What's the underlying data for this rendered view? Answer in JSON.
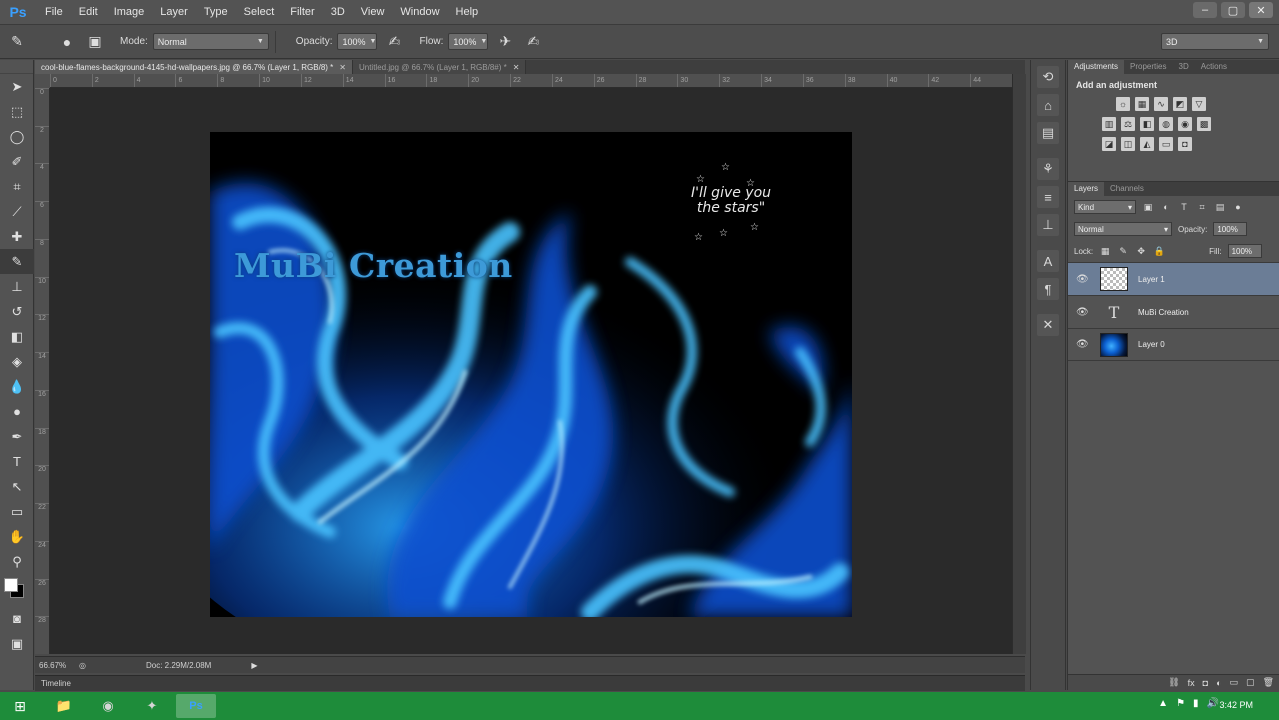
{
  "menubar": {
    "logo": "Ps",
    "items": [
      "File",
      "Edit",
      "Image",
      "Layer",
      "Type",
      "Select",
      "Filter",
      "3D",
      "View",
      "Window",
      "Help"
    ],
    "window_controls": [
      "–",
      "▢",
      "✕"
    ]
  },
  "options": {
    "mode_label": "Mode:",
    "mode_value": "Normal",
    "opacity_label": "Opacity:",
    "opacity_value": "100%",
    "flow_label": "Flow:",
    "flow_value": "100%",
    "workspace_value": "3D"
  },
  "doc_tabs": [
    {
      "label": "cool-blue-flames-background-4145-hd-wallpapers.jpg @ 66.7% (Layer 1, RGB/8) *",
      "active": true
    },
    {
      "label": "Untitled.jpg @ 66.7% (Layer 1, RGB/8#) *",
      "active": false
    }
  ],
  "ruler": {
    "h_ticks": [
      "0",
      "2",
      "4",
      "6",
      "8",
      "10",
      "12",
      "14",
      "16",
      "18",
      "20",
      "22",
      "24",
      "26",
      "28",
      "30",
      "32",
      "34",
      "36",
      "38",
      "40",
      "42",
      "44"
    ],
    "v_ticks": [
      "0",
      "2",
      "4",
      "6",
      "8",
      "10",
      "12",
      "14",
      "16",
      "18",
      "20",
      "22",
      "24",
      "26",
      "28"
    ]
  },
  "artwork": {
    "title": "MuBi Creation",
    "tagline_line1": "I'll give you",
    "tagline_line2": "the stars\""
  },
  "status": {
    "zoom": "66.67%",
    "doc_info": "Doc: 2.29M/2.08M",
    "timeline": "Timeline"
  },
  "adjustments": {
    "tabs": [
      "Adjustments",
      "Properties",
      "3D",
      "Actions"
    ],
    "title": "Add an adjustment"
  },
  "layers": {
    "tabs": [
      "Layers",
      "Channels"
    ],
    "kind_value": "Kind",
    "blend_value": "Normal",
    "opacity_label": "Opacity:",
    "opacity_value": "100%",
    "lock_label": "Lock:",
    "fill_label": "Fill:",
    "fill_value": "100%",
    "items": [
      {
        "name": "Layer 1",
        "thumb": "transparent",
        "selected": true
      },
      {
        "name": "MuBi Creation",
        "thumb": "type",
        "selected": false
      },
      {
        "name": "Layer 0",
        "thumb": "image",
        "selected": false
      }
    ]
  },
  "taskbar": {
    "clock": "3:42 PM"
  },
  "colors": {
    "accent_blue": "#3aa0ff",
    "taskbar_green": "#1e8c3a",
    "flame_light": "#49c3ff",
    "flame_deep": "#0c4fcf"
  }
}
